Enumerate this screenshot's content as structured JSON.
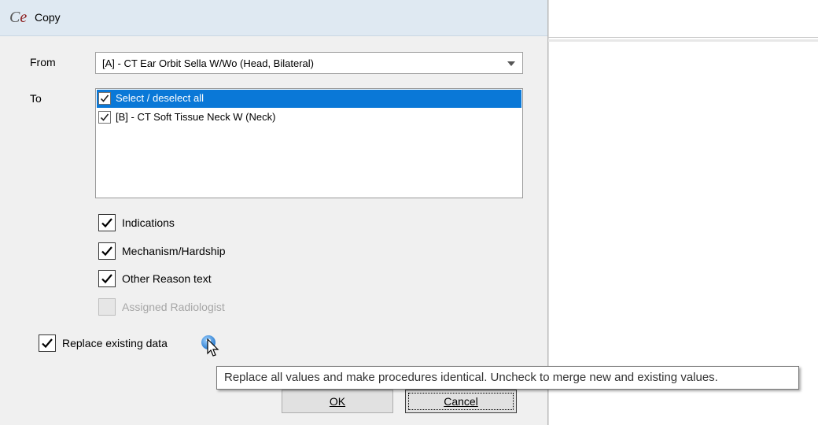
{
  "window": {
    "title": "Copy",
    "logo_text": "Ce"
  },
  "form": {
    "from_label": "From",
    "from_value": "[A] - CT Ear Orbit Sella W/Wo (Head, Bilateral)",
    "to_label": "To",
    "to_items": [
      {
        "label": "Select / deselect all",
        "checked": true,
        "selected": true
      },
      {
        "label": "[B] - CT Soft Tissue Neck W (Neck)",
        "checked": true,
        "selected": false
      }
    ]
  },
  "options": [
    {
      "label": "Indications",
      "checked": true,
      "enabled": true
    },
    {
      "label": "Mechanism/Hardship",
      "checked": true,
      "enabled": true
    },
    {
      "label": "Other Reason text",
      "checked": true,
      "enabled": true
    },
    {
      "label": "Assigned Radiologist",
      "checked": false,
      "enabled": false
    }
  ],
  "replace": {
    "label": "Replace existing data",
    "checked": true
  },
  "tooltip": {
    "text": "Replace all values and make procedures identical. Uncheck to merge new and existing values."
  },
  "buttons": {
    "ok": "OK",
    "cancel": "Cancel"
  },
  "colors": {
    "selection": "#0a78d7",
    "titlebar": "#dfe9f2",
    "dialog_bg": "#f0f0f0"
  }
}
